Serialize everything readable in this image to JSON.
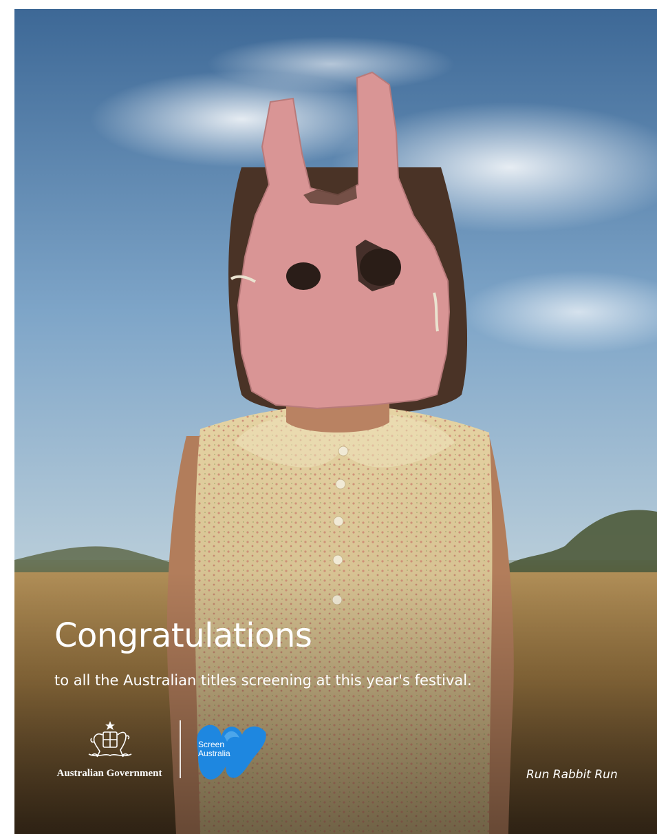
{
  "headline": "Congratulations",
  "subline": "to all the Australian titles screening at this year's festival.",
  "government_logo": {
    "name": "Australian Government",
    "icon": "coat-of-arms-icon"
  },
  "screen_australia_logo": {
    "line1": "Screen",
    "line2": "Australia",
    "color": "#1e87e0",
    "icon": "screen-australia-wave-icon"
  },
  "film_title": "Run Rabbit Run"
}
